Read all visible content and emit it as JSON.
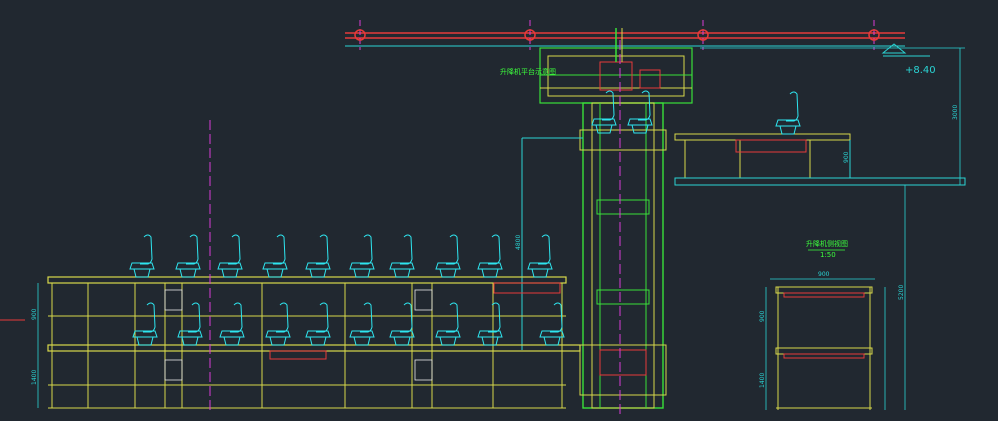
{
  "colors": {
    "background": "#212830",
    "frame": "#d8d84a",
    "seat": "#2ee6f0",
    "structure_green": "#39e039",
    "dimension": "#2ad4d4",
    "centerline": "#d63cd6",
    "accent_red": "#e63a3a",
    "text_green": "#3cff3c",
    "white": "#e8e8e8"
  },
  "labels": {
    "level_mark": "+8.40",
    "section_title": "升降机侧视图",
    "section_scale": "1:50",
    "lift_label": "升降机平台示意图"
  },
  "dimensions": {
    "left_upper_tier": "900",
    "left_lower_tier": "1400",
    "column_height": "4800",
    "upper_platform_height": "900",
    "total_height_right": "5200",
    "top_right_height": "3000",
    "section_width": "900",
    "section_upper_tier": "900",
    "section_lower_tier": "1400"
  }
}
